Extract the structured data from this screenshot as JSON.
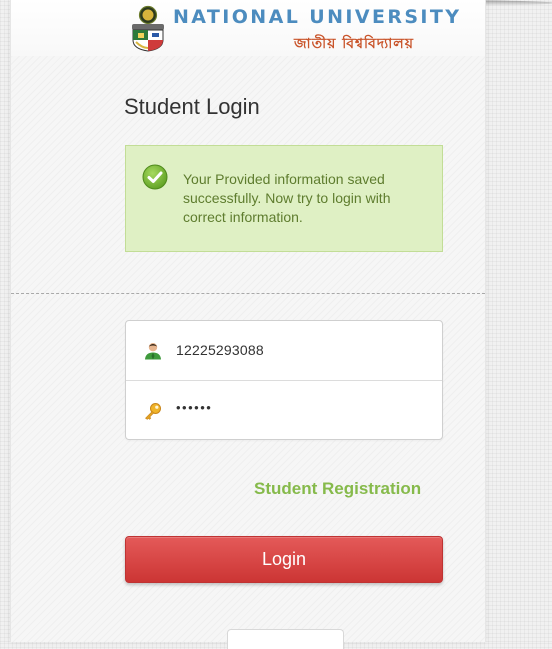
{
  "brand": {
    "name_en": "NATIONAL UNIVERSITY",
    "name_bn": "জাতীয় বিশ্ববিদ্যালয়",
    "logo_icon": "university-seal-icon"
  },
  "login": {
    "title": "Student Login",
    "alert": {
      "icon": "check-circle-icon",
      "message": "Your Provided information saved successfully. Now try to login with correct information."
    },
    "username": {
      "icon": "user-icon",
      "value": "12225293088"
    },
    "password": {
      "icon": "key-icon",
      "value": "••••••"
    },
    "registration_link": "Student Registration",
    "login_button": "Login"
  },
  "colors": {
    "brand_blue": "#4c8cbf",
    "brand_bn": "#c9542a",
    "success_bg": "#dff0c4",
    "success_text": "#5e7c2e",
    "link_green": "#86ba4b",
    "button_red": "#d9403f"
  }
}
